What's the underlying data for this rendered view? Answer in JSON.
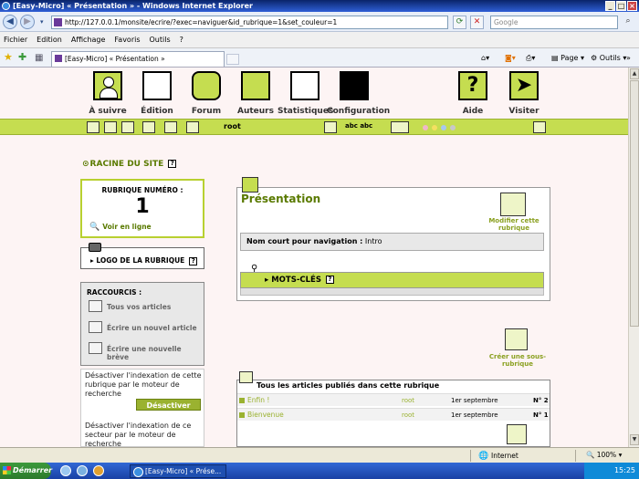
{
  "window": {
    "title": "[Easy-Micro] « Présentation » - Windows Internet Explorer",
    "controls": [
      "_",
      "□",
      "×"
    ]
  },
  "address": {
    "url": "http://127.0.0.1/monsite/ecrire/?exec=naviguer&id_rubrique=1&set_couleur=1",
    "search_placeholder": "Google"
  },
  "menu": [
    "Fichier",
    "Edition",
    "Affichage",
    "Favoris",
    "Outils",
    "?"
  ],
  "tab": {
    "label": "[Easy-Micro] « Présentation »",
    "page_label": "Page",
    "tools_label": "Outils"
  },
  "nav": [
    {
      "label": "À suivre"
    },
    {
      "label": "Édition"
    },
    {
      "label": "Forum"
    },
    {
      "label": "Auteurs"
    },
    {
      "label": "Statistiques"
    },
    {
      "label": "Configuration"
    },
    {
      "label": "Aide"
    },
    {
      "label": "Visiter"
    }
  ],
  "toolbar": {
    "user": "root",
    "abc": "abc abc"
  },
  "left": {
    "racine": "RACINE DU SITE",
    "help": "?",
    "rubrique_title": "RUBRIQUE NUMÉRO :",
    "rubrique_num": "1",
    "voir_en_ligne": "Voir en ligne",
    "logo_label": "▸ LOGO DE LA RUBRIQUE",
    "raccourcis_title": "RACCOURCIS :",
    "raccourcis": [
      "Tous vos articles",
      "Écrire un nouvel article",
      "Écrire une nouvelle brève"
    ],
    "index_text_1": "Désactiver l'indexation de cette rubrique par le moteur de recherche",
    "desactiver": "Désactiver",
    "index_text_2": "Désactiver l'indexation de ce secteur par le moteur de recherche"
  },
  "main": {
    "title": "Présentation",
    "modifier": "Modifier cette rubrique",
    "nom_court_label": "Nom court pour navigation :",
    "nom_court_value": "Intro",
    "motscles": "▸ MOTS-CLÉS",
    "creer": "Créer une sous-rubrique",
    "articles_header": "Tous les articles publiés dans cette rubrique",
    "articles": [
      {
        "title": "Enfin !",
        "author": "root",
        "date": "1er septembre",
        "num": "N° 2"
      },
      {
        "title": "Bienvenue",
        "author": "root",
        "date": "1er septembre",
        "num": "N° 1"
      }
    ]
  },
  "status": {
    "zone": "Internet",
    "zoom": "100%"
  },
  "taskbar": {
    "start": "Démarrer",
    "item": "[Easy-Micro] « Prése...",
    "time": "15:25"
  },
  "colors": {
    "spip_green": "#c5dd50",
    "spip_dark_green": "#5a7a00",
    "xp_blue": "#0a246a"
  }
}
